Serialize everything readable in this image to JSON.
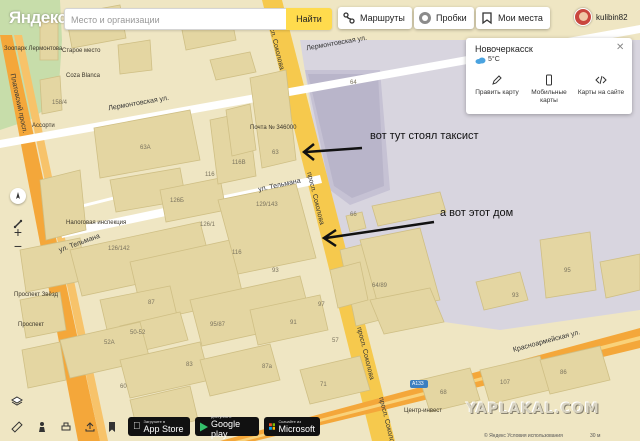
{
  "header": {
    "logo": "Яндекс",
    "search_placeholder": "Место и организации",
    "search_button": "Найти",
    "routes_label": "Маршруты",
    "traffic_label": "Пробки",
    "myplaces_label": "Мои места",
    "username": "kulibin82"
  },
  "weather_card": {
    "city": "Новочеркасск",
    "temperature": "5°C",
    "actions": [
      {
        "label": "Править карту",
        "icon": "pencil-icon"
      },
      {
        "label": "Мобильные карты",
        "icon": "phone-icon"
      },
      {
        "label": "Карты на сайте",
        "icon": "code-icon"
      }
    ]
  },
  "annotations": {
    "taxi": "вот тут стоял таксист",
    "house": "а вот этот дом"
  },
  "streets": {
    "lermontovskaya_top": "Лермонтовская ул.",
    "lermontovskaya_left": "Лермонтовская ул.",
    "sokolova_top": "просп. Соколова",
    "sokolova_mid": "просп. Соколова",
    "sokolova_bottom": "просп. Соколова",
    "sokolova_bottom2": "просп. Соколова",
    "tolmach_top": "ул. Тельмана",
    "tolmach_left": "ул. Тельмана",
    "krasnoarm": "Красноармейская ул.",
    "platov": "Платовский просп."
  },
  "pois": {
    "zoo": "Зоопарк Лермонтова",
    "staroe_mesto": "Старое место",
    "cosa_blanca": "Coza Blanca",
    "assorti": "Ассорти",
    "pochta": "Почта № 346000",
    "nalogovaya": "Налоговая инспекция",
    "prospekt_zvezd": "Проспект Звёзд",
    "prospekt": "Проспект",
    "centr": "Центр-инвест"
  },
  "house_numbers": [
    "158/4",
    "63А",
    "63",
    "116",
    "116В",
    "126Б",
    "129/143",
    "126/1",
    "126/142",
    "93",
    "116",
    "64",
    "66",
    "95",
    "93",
    "64/89",
    "97",
    "95/87",
    "87",
    "91",
    "50-52",
    "52А",
    "57",
    "87а",
    "83",
    "60",
    "68",
    "107",
    "86",
    "71"
  ],
  "route_badge": "A133",
  "bottom": {
    "appstore_sub": "Загрузите в",
    "appstore": "App Store",
    "googleplay_sub": "доступно в",
    "googleplay": "Google play",
    "microsoft_sub": "Скачайте из",
    "microsoft": "Microsoft",
    "copyright": "© Яндекс Условия использования",
    "scale": "30 м",
    "watermark": "YAPLAKAL.COM"
  },
  "colors": {
    "map_bg": "#efe6c3",
    "building": "#e4d6a2",
    "road_main": "#f6c94d",
    "road_major": "#f4a73a",
    "road_minor": "#ffffff",
    "industrial": "#d9d5e4",
    "accent_yellow": "#ffdb4d"
  }
}
